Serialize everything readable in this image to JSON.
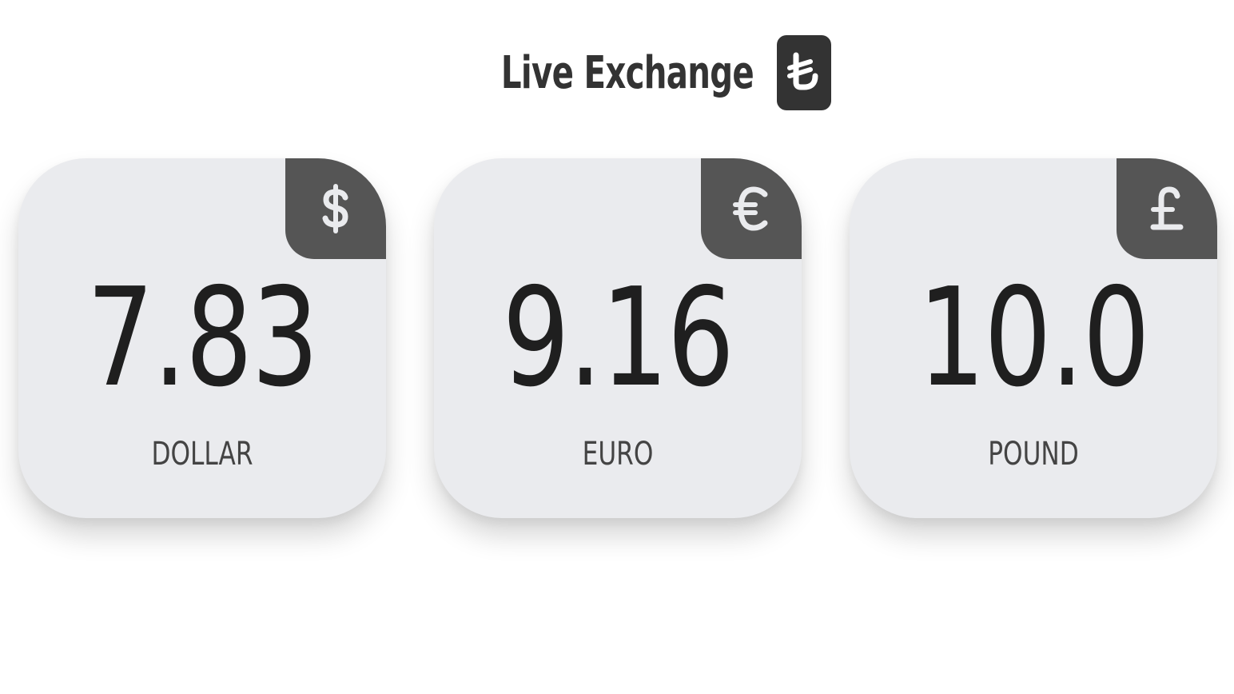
{
  "header": {
    "title": "Live Exchange",
    "icon": "turkish-lira-icon"
  },
  "cards": [
    {
      "label": "DOLLAR",
      "value": "7.83",
      "icon": "dollar-icon"
    },
    {
      "label": "EURO",
      "value": "9.16",
      "icon": "euro-icon"
    },
    {
      "label": "POUND",
      "value": "10.0",
      "icon": "pound-icon"
    }
  ],
  "colors": {
    "card_bg": "#eaebee",
    "corner_bg": "#555555",
    "badge_bg": "#333333",
    "icon_fg": "#eaebee"
  }
}
